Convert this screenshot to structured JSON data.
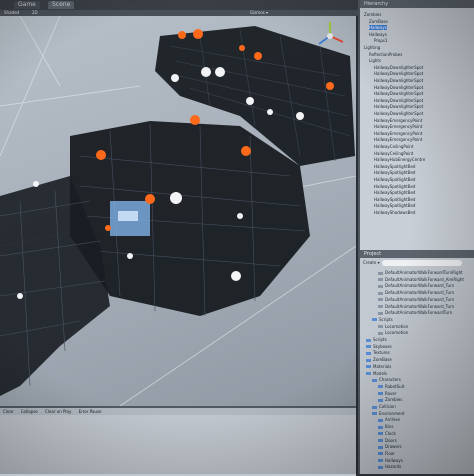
{
  "tabs": {
    "game": "Game",
    "scene": "Scene"
  },
  "toolbar": {
    "shaded": "Shaded",
    "twod": "2D",
    "gizmos": "Gizmos ▾",
    "persp": "Persp"
  },
  "hierarchy": {
    "title": "Hierarchy",
    "items": [
      {
        "label": "Zombies",
        "indent": 0,
        "selected": false
      },
      {
        "label": "ZomBase",
        "indent": 1,
        "selected": false
      },
      {
        "label": "Hallways",
        "indent": 1,
        "selected": true
      },
      {
        "label": "Hallways",
        "indent": 1,
        "selected": false
      },
      {
        "label": "Props1",
        "indent": 2,
        "selected": false
      },
      {
        "label": "Lighting",
        "indent": 0,
        "selected": false
      },
      {
        "label": "ReflectionProbes",
        "indent": 1,
        "selected": false
      },
      {
        "label": "Lights",
        "indent": 1,
        "selected": false
      },
      {
        "label": "HallwayDownlighterSpot",
        "indent": 2,
        "selected": false
      },
      {
        "label": "HallwayDownlighterSpot",
        "indent": 2,
        "selected": false
      },
      {
        "label": "HallwayDownlighterSpot",
        "indent": 2,
        "selected": false
      },
      {
        "label": "HallwayDownlighterSpot",
        "indent": 2,
        "selected": false
      },
      {
        "label": "HallwayDownlighterSpot",
        "indent": 2,
        "selected": false
      },
      {
        "label": "HallwayDownlighterSpot",
        "indent": 2,
        "selected": false
      },
      {
        "label": "HallwayDownlighterSpot",
        "indent": 2,
        "selected": false
      },
      {
        "label": "HallwayDownlighterSpot",
        "indent": 2,
        "selected": false
      },
      {
        "label": "HallwayEmergencyPoint",
        "indent": 2,
        "selected": false
      },
      {
        "label": "HallwayEmergencyPoint",
        "indent": 2,
        "selected": false
      },
      {
        "label": "HallwayEmergencyPoint",
        "indent": 2,
        "selected": false
      },
      {
        "label": "HallwayEmergencyPoint",
        "indent": 2,
        "selected": false
      },
      {
        "label": "HallwayCeilingPoint",
        "indent": 2,
        "selected": false
      },
      {
        "label": "HallwayCeilingPoint",
        "indent": 2,
        "selected": false
      },
      {
        "label": "HallwayHubEnergyCentre",
        "indent": 2,
        "selected": false
      },
      {
        "label": "HallwaySpotlightBed",
        "indent": 2,
        "selected": false
      },
      {
        "label": "HallwaySpotlightBed",
        "indent": 2,
        "selected": false
      },
      {
        "label": "HallwaySpotlightBed",
        "indent": 2,
        "selected": false
      },
      {
        "label": "HallwaySpotlightBed",
        "indent": 2,
        "selected": false
      },
      {
        "label": "HallwaySpotlightBed",
        "indent": 2,
        "selected": false
      },
      {
        "label": "HallwaySpotlightBed",
        "indent": 2,
        "selected": false
      },
      {
        "label": "HallwaySpotlightBed",
        "indent": 2,
        "selected": false
      },
      {
        "label": "HallwayShadowsBed",
        "indent": 2,
        "selected": false
      }
    ]
  },
  "project": {
    "title": "Project",
    "create": "Create ▾",
    "items": [
      {
        "label": "DefaultAnimatorWalkForwardTurnRight",
        "indent": 2,
        "folder": false
      },
      {
        "label": "DefaultAnimatorWalkForward_AimRight",
        "indent": 2,
        "folder": false
      },
      {
        "label": "DefaultAnimatorWalkForward_Turn",
        "indent": 2,
        "folder": false
      },
      {
        "label": "DefaultAnimatorWalkForward_Turn",
        "indent": 2,
        "folder": false
      },
      {
        "label": "DefaultAnimatorWalkForward_Turn",
        "indent": 2,
        "folder": false
      },
      {
        "label": "DefaultAnimatorWalkForward_Turn",
        "indent": 2,
        "folder": false
      },
      {
        "label": "DefaultAnimatorWalkForwardTurn",
        "indent": 2,
        "folder": false
      },
      {
        "label": "Scripts",
        "indent": 1,
        "folder": true
      },
      {
        "label": "Locomotion",
        "indent": 2,
        "folder": false
      },
      {
        "label": "Locomotion",
        "indent": 2,
        "folder": false
      },
      {
        "label": "Scripts",
        "indent": 0,
        "folder": true
      },
      {
        "label": "Skyboxes",
        "indent": 0,
        "folder": true
      },
      {
        "label": "Textures",
        "indent": 0,
        "folder": true
      },
      {
        "label": "ZomBase",
        "indent": 0,
        "folder": true
      },
      {
        "label": "Materials",
        "indent": 0,
        "folder": true
      },
      {
        "label": "Models",
        "indent": 0,
        "folder": true
      },
      {
        "label": "Characters",
        "indent": 1,
        "folder": true
      },
      {
        "label": "RobotSuit",
        "indent": 2,
        "folder": true
      },
      {
        "label": "Rover",
        "indent": 2,
        "folder": true
      },
      {
        "label": "Zombies",
        "indent": 2,
        "folder": true
      },
      {
        "label": "Collision",
        "indent": 1,
        "folder": true
      },
      {
        "label": "Environment",
        "indent": 1,
        "folder": true
      },
      {
        "label": "Archive",
        "indent": 2,
        "folder": true
      },
      {
        "label": "Bins",
        "indent": 2,
        "folder": true
      },
      {
        "label": "Clock",
        "indent": 2,
        "folder": true
      },
      {
        "label": "Doors",
        "indent": 2,
        "folder": true
      },
      {
        "label": "Drawers",
        "indent": 2,
        "folder": true
      },
      {
        "label": "Floor",
        "indent": 2,
        "folder": true
      },
      {
        "label": "Hallways",
        "indent": 2,
        "folder": true
      },
      {
        "label": "Hazards",
        "indent": 2,
        "folder": true
      }
    ]
  },
  "console": {
    "clear": "Clear",
    "collapse": "Collapse",
    "clear_on_play": "Clear on Play",
    "error_pause": "Error Pause"
  },
  "colors": {
    "accent": "#3d7fd8",
    "light_warm": "#ff6a1a",
    "light_white": "#f2f4f6"
  }
}
